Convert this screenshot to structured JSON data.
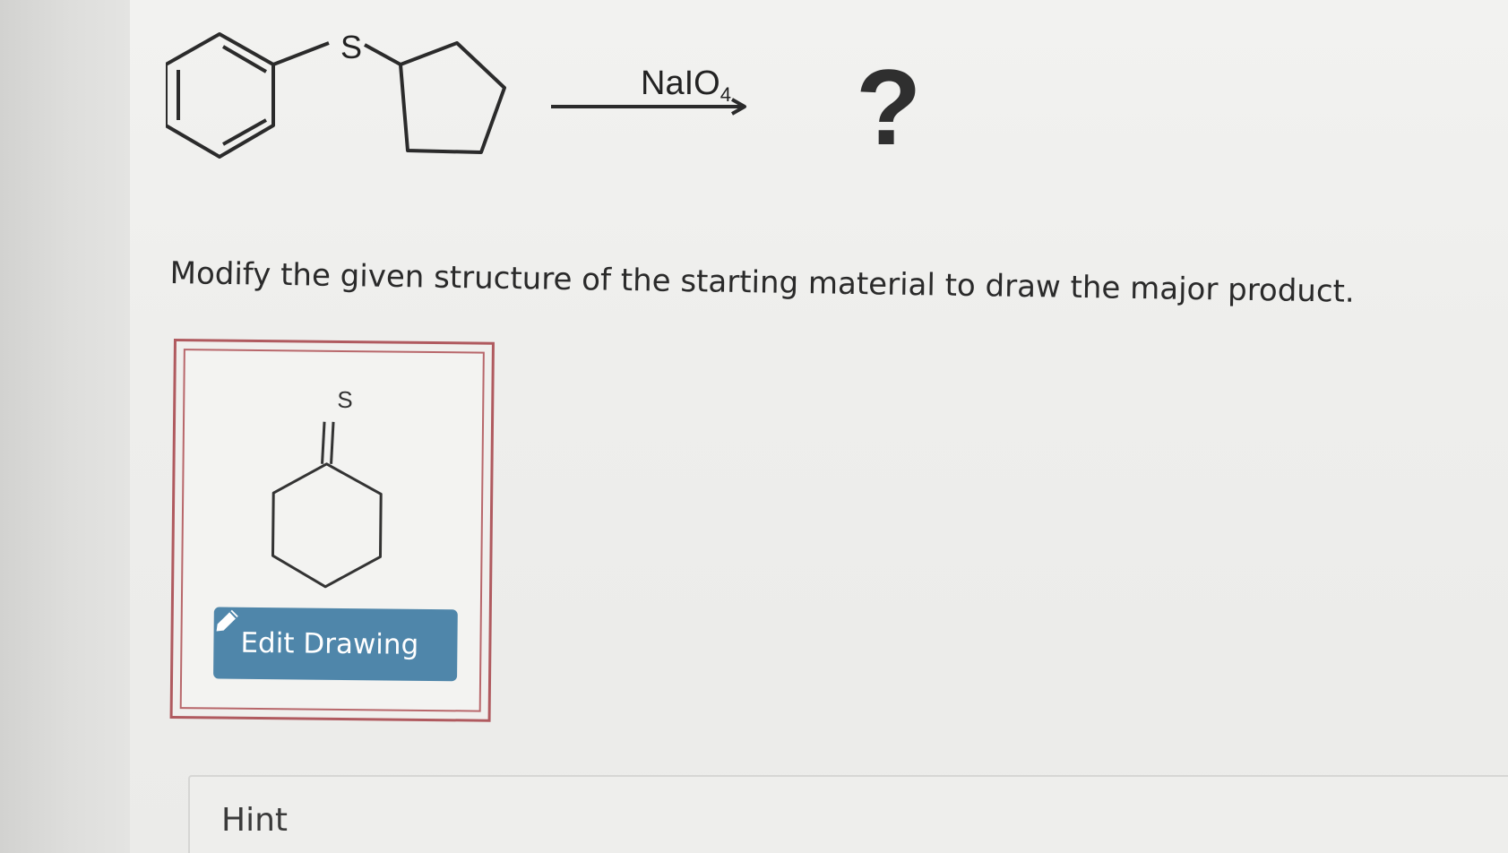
{
  "reaction": {
    "heteroatom_label": "S",
    "reagent": "NaIO",
    "reagent_subscript": "4",
    "product_placeholder": "?"
  },
  "question": {
    "instruction": "Modify the given structure of the starting material to draw the major product."
  },
  "drawing_area": {
    "atom_label": "S",
    "edit_button_label": "Edit Drawing",
    "edit_button_icon": "pencil-icon"
  },
  "hint": {
    "label": "Hint"
  },
  "colors": {
    "button": "#4f86aa",
    "frame_border": "#b05a5f",
    "text": "#2a2a2a"
  }
}
